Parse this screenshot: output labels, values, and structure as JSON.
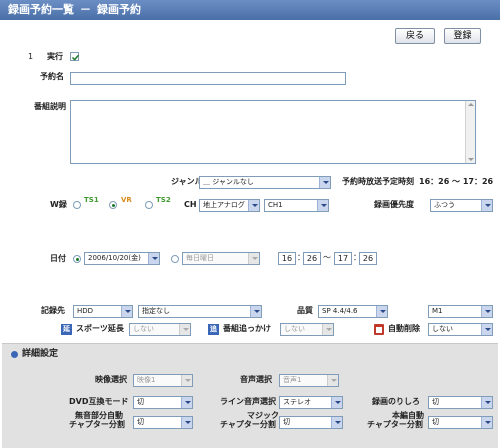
{
  "header": {
    "title": "録画予約一覧",
    "separator": "－",
    "subtitle": "録画予約"
  },
  "toolbar": {
    "back_label": "戻る",
    "register_label": "登録"
  },
  "form": {
    "row_number": "1",
    "execute_label": "実行",
    "execute_checked": true,
    "reservation_name_label": "予約名",
    "reservation_name_value": "",
    "program_desc_label": "番組説明",
    "program_desc_value": "",
    "genre_label": "ジャンル",
    "genre_value": "＿ ジャンルなし",
    "scheduled_time_label": "予約時放送予定時刻",
    "scheduled_time_value": "16：26 ～ 17：26",
    "w_rec_label": "W録",
    "w_rec_options": [
      {
        "icon": "TS1",
        "selected": false,
        "color": "#3f9a2f"
      },
      {
        "icon": "VR",
        "selected": true,
        "color": "#d98a1a"
      },
      {
        "icon": "TS2",
        "selected": false,
        "color": "#3f9a2f"
      }
    ],
    "ch_label": "CH",
    "ch_band_value": "地上アナログ",
    "ch_value": "CH1",
    "rec_priority_label": "録画優先度",
    "rec_priority_value": "ふつう",
    "date_label": "日付",
    "date_value": "2006/10/20(金)",
    "date_selected": true,
    "weekly_value": "毎日曜日",
    "weekly_selected": false,
    "start_hour": "16",
    "start_min": "26",
    "time_sep": "：",
    "range_sep": "～",
    "end_hour": "17",
    "end_min": "26",
    "dest_label": "記録先",
    "dest_value": "HDD",
    "folder_value": "指定なし",
    "quality_label": "品質",
    "quality_value": "SP 4.4/4.6",
    "mode_value": "M1",
    "sports_ext_label": "スポーツ延長",
    "sports_ext_value": "しない",
    "program_follow_label": "番組追っかけ",
    "program_follow_value": "しない",
    "auto_delete_label": "自動削除",
    "auto_delete_value": "しない",
    "sports_icon": "延",
    "follow_icon": "追"
  },
  "details": {
    "title": "詳細設定",
    "video_select_label": "映像選択",
    "video_select_value": "映像1",
    "audio_select_label": "音声選択",
    "audio_select_value": "音声1",
    "dvd_mode_label": "DVD互換モード",
    "dvd_mode_value": "切",
    "line_audio_label": "ライン音声選択",
    "line_audio_value": "ステレオ",
    "rec_margin_label": "録画のりしろ",
    "rec_margin_value": "切",
    "silent_chapter_label_1": "無音部分自動",
    "silent_chapter_label_2": "チャプター分割",
    "silent_chapter_value": "切",
    "magic_chapter_label_1": "マジック",
    "magic_chapter_label_2": "チャプター分割",
    "magic_chapter_value": "切",
    "main_chapter_label_1": "本編自動",
    "main_chapter_label_2": "チャプター分割",
    "main_chapter_value": "切"
  },
  "colors": {
    "header": "#4a6fa8",
    "panel": "#e1e1e1",
    "accent_blue": "#3a66b8",
    "delete_red": "#c0392b"
  }
}
